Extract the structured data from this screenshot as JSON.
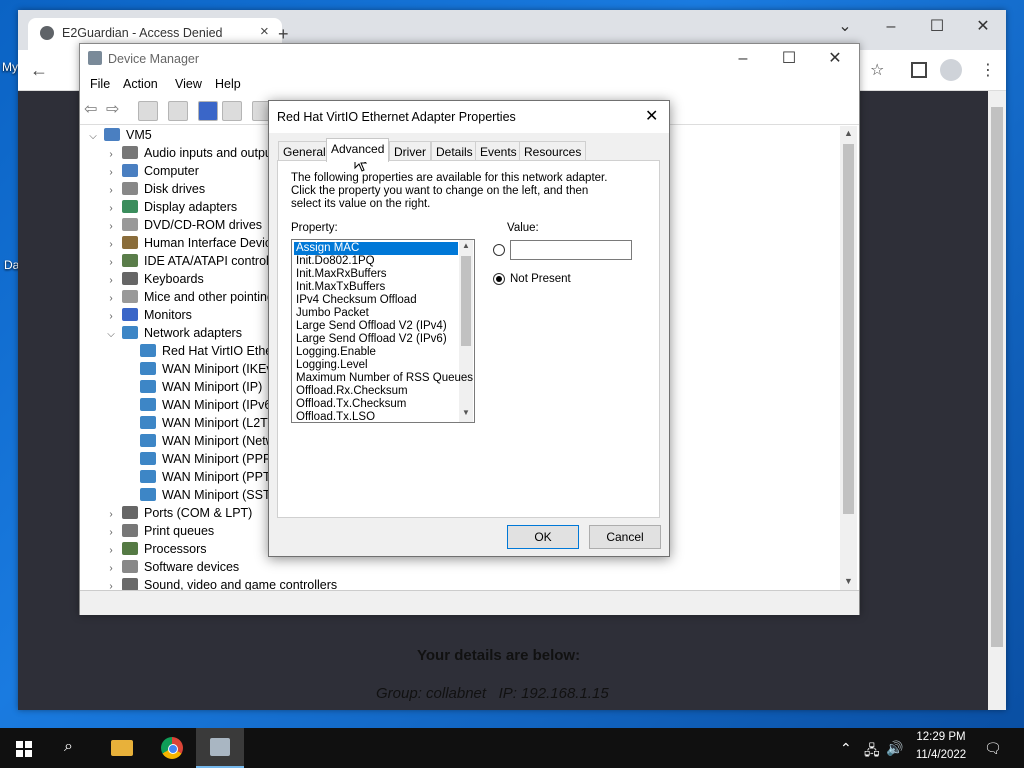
{
  "desktop": {
    "icon_labels": [
      "My",
      "Da"
    ]
  },
  "chrome": {
    "tab_title": "E2Guardian - Access Denied",
    "new_tab_glyph": "+",
    "page_heading": "Your details are below:",
    "page_details": "Group: collabnet   IP: 192.168.1.15"
  },
  "device_manager": {
    "title": "Device Manager",
    "menu": [
      "File",
      "Action",
      "View",
      "Help"
    ],
    "tree": [
      {
        "label": "VM5",
        "level": 0,
        "expanded": true,
        "icon": "computer-icon"
      },
      {
        "label": "Audio inputs and outputs",
        "level": 1,
        "icon": "speaker-icon"
      },
      {
        "label": "Computer",
        "level": 1,
        "icon": "computer-icon"
      },
      {
        "label": "Disk drives",
        "level": 1,
        "icon": "disk-icon"
      },
      {
        "label": "Display adapters",
        "level": 1,
        "icon": "display-icon"
      },
      {
        "label": "DVD/CD-ROM drives",
        "level": 1,
        "icon": "dvd-icon"
      },
      {
        "label": "Human Interface Devices",
        "level": 1,
        "icon": "hid-icon"
      },
      {
        "label": "IDE ATA/ATAPI controllers",
        "level": 1,
        "icon": "ide-icon"
      },
      {
        "label": "Keyboards",
        "level": 1,
        "icon": "keyboard-icon"
      },
      {
        "label": "Mice and other pointing devices",
        "level": 1,
        "icon": "mouse-icon"
      },
      {
        "label": "Monitors",
        "level": 1,
        "icon": "monitor-icon"
      },
      {
        "label": "Network adapters",
        "level": 1,
        "expanded": true,
        "icon": "network-icon"
      },
      {
        "label": "Red Hat VirtIO Ethernet Adapter",
        "level": 2,
        "icon": "network-icon"
      },
      {
        "label": "WAN Miniport (IKEv2)",
        "level": 2,
        "icon": "network-icon"
      },
      {
        "label": "WAN Miniport (IP)",
        "level": 2,
        "icon": "network-icon"
      },
      {
        "label": "WAN Miniport (IPv6)",
        "level": 2,
        "icon": "network-icon"
      },
      {
        "label": "WAN Miniport (L2TP)",
        "level": 2,
        "icon": "network-icon"
      },
      {
        "label": "WAN Miniport (Network Monitor)",
        "level": 2,
        "icon": "network-icon"
      },
      {
        "label": "WAN Miniport (PPPOE)",
        "level": 2,
        "icon": "network-icon"
      },
      {
        "label": "WAN Miniport (PPTP)",
        "level": 2,
        "icon": "network-icon"
      },
      {
        "label": "WAN Miniport (SSTP)",
        "level": 2,
        "icon": "network-icon"
      },
      {
        "label": "Ports (COM & LPT)",
        "level": 1,
        "icon": "port-icon"
      },
      {
        "label": "Print queues",
        "level": 1,
        "icon": "printer-icon"
      },
      {
        "label": "Processors",
        "level": 1,
        "icon": "processor-icon"
      },
      {
        "label": "Software devices",
        "level": 1,
        "icon": "software-icon"
      },
      {
        "label": "Sound, video and game controllers",
        "level": 1,
        "icon": "sound-icon"
      }
    ]
  },
  "dialog": {
    "title": "Red Hat VirtIO Ethernet Adapter Properties",
    "tabs": [
      "General",
      "Advanced",
      "Driver",
      "Details",
      "Events",
      "Resources"
    ],
    "active_tab": "Advanced",
    "description": "The following properties are available for this network adapter. Click the property you want to change on the left, and then select its value on the right.",
    "property_label": "Property:",
    "value_label": "Value:",
    "value_input": "",
    "not_present_label": "Not Present",
    "selected_radio": "Not Present",
    "properties": [
      "Assign MAC",
      "Init.Do802.1PQ",
      "Init.MaxRxBuffers",
      "Init.MaxTxBuffers",
      "IPv4 Checksum Offload",
      "Jumbo Packet",
      "Large Send Offload V2 (IPv4)",
      "Large Send Offload V2 (IPv6)",
      "Logging.Enable",
      "Logging.Level",
      "Maximum Number of RSS Queues",
      "Offload.Rx.Checksum",
      "Offload.Tx.Checksum",
      "Offload.Tx.LSO"
    ],
    "selected_property": "Assign MAC",
    "ok_label": "OK",
    "cancel_label": "Cancel"
  },
  "taskbar": {
    "time": "12:29 PM",
    "date": "11/4/2022"
  },
  "colors": {
    "accent": "#0078d7",
    "taskbar": "#101010",
    "page_bg": "#2e2f38"
  }
}
